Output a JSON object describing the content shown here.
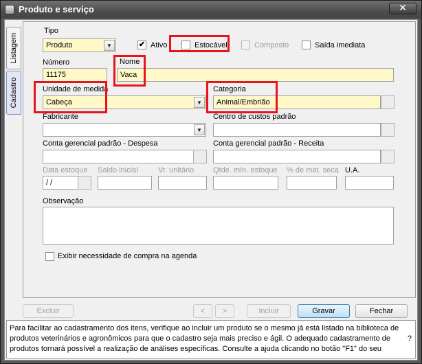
{
  "window": {
    "title": "Produto e serviço",
    "close_glyph": "✕"
  },
  "side_tabs": [
    {
      "label": "Listagem"
    },
    {
      "label": "Cadastro"
    }
  ],
  "form": {
    "tipo_label": "Tipo",
    "tipo_value": "Produto",
    "ativo_label": "Ativo",
    "ativo_checked": "✔",
    "estocavel_label": "Estocável",
    "composto_label": "Composto",
    "saida_label": "Saída imediata",
    "numero_label": "Número",
    "numero_value": "11175",
    "nome_label": "Nome",
    "nome_value": "Vaca",
    "unidade_label": "Unidade de medida",
    "unidade_value": "Cabeça",
    "categoria_label": "Categoria",
    "categoria_value": "Animal/Embrião",
    "fabricante_label": "Fabricante",
    "centro_label": "Centro de custos padrão",
    "despesa_label": "Conta gerencial padrão - Despesa",
    "receita_label": "Conta gerencial padrão - Receita",
    "data_estoque_label": "Data estoque",
    "data_estoque_value": " /  /",
    "saldo_label": "Saldo inicial",
    "vr_label": "Vr. unitário",
    "qtde_label": "Qtde. mín. estoque",
    "mat_seca_label": "% de mat. seca",
    "ua_label": "U.A.",
    "observacao_label": "Observação",
    "exibir_label": "Exibir necessidade de compra na agenda"
  },
  "buttons": {
    "excluir": "Excluir",
    "prev": "<",
    "next": ">",
    "incluir": "Incluir",
    "gravar": "Gravar",
    "fechar": "Fechar"
  },
  "help": {
    "text": "Para facilitar ao cadastramento dos itens, verifique ao incluir um produto se o mesmo já está listado na biblioteca de produtos veterinários e agronômicos para que o cadastro seja mais preciso e ágil. O adequado cadastramento de produtos tornará possível a realização de análises específicas. Consulte a ajuda clicando no botão \"F1\" do seu",
    "question": "?"
  },
  "colors": {
    "highlight": "#e8131b",
    "yellow_field": "#fff8c8"
  }
}
